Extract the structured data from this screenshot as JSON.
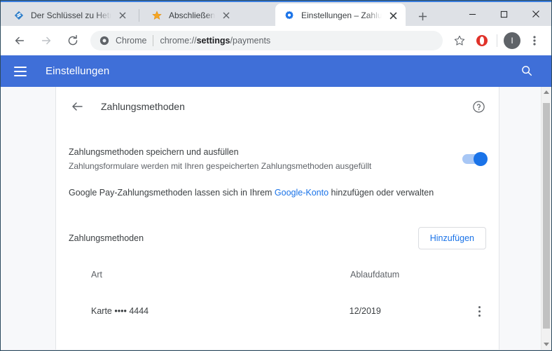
{
  "browser": {
    "tabs": [
      {
        "title": "Der Schlüssel zu Hetman P",
        "favicon": "hetman-logo-icon",
        "active": false
      },
      {
        "title": "Abschließen",
        "favicon": "star-icon",
        "active": false
      },
      {
        "title": "Einstellungen – Zahlungsm",
        "favicon": "gear-icon",
        "active": true
      }
    ],
    "new_tab_label": "+",
    "window_controls": {
      "minimize": "—",
      "maximize": "□",
      "close": "✕"
    },
    "nav": {
      "back": "back-arrow-icon",
      "forward": "forward-arrow-icon",
      "reload": "reload-icon"
    },
    "omnibox": {
      "scheme_label": "Chrome",
      "url_prefix": "chrome://",
      "url_bold": "settings",
      "url_suffix": "/payments"
    },
    "toolbar_icons": {
      "bookmark": "star-outline-icon",
      "extension": "opera-extension-icon",
      "profile_initial": "I",
      "menu": "three-dot-menu-icon"
    }
  },
  "settings_header": {
    "menu_label": "hamburger-menu-icon",
    "title": "Einstellungen",
    "search_label": "search-icon",
    "accent_color": "#3f6fd8"
  },
  "content": {
    "back_label": "back-arrow-icon",
    "page_title": "Zahlungsmethoden",
    "help_label": "help-icon",
    "autofill": {
      "label": "Zahlungsmethoden speichern und ausfüllen",
      "sublabel": "Zahlungsformulare werden mit Ihren gespeicherten Zahlungsmethoden ausgefüllt",
      "enabled": true
    },
    "google_pay": {
      "text_before": "Google Pay-Zahlungsmethoden lassen sich in Ihrem ",
      "link_text": "Google-Konto",
      "text_after": " hinzufügen oder verwalten",
      "link_color": "#1a73e8"
    },
    "methods_section": {
      "title": "Zahlungsmethoden",
      "add_button": "Hinzufügen"
    },
    "table": {
      "columns": [
        "Art",
        "Ablaufdatum"
      ],
      "rows": [
        {
          "type": "Karte  ••••  4444",
          "expiry": "12/2019",
          "menu": "row-menu-icon"
        }
      ]
    }
  }
}
